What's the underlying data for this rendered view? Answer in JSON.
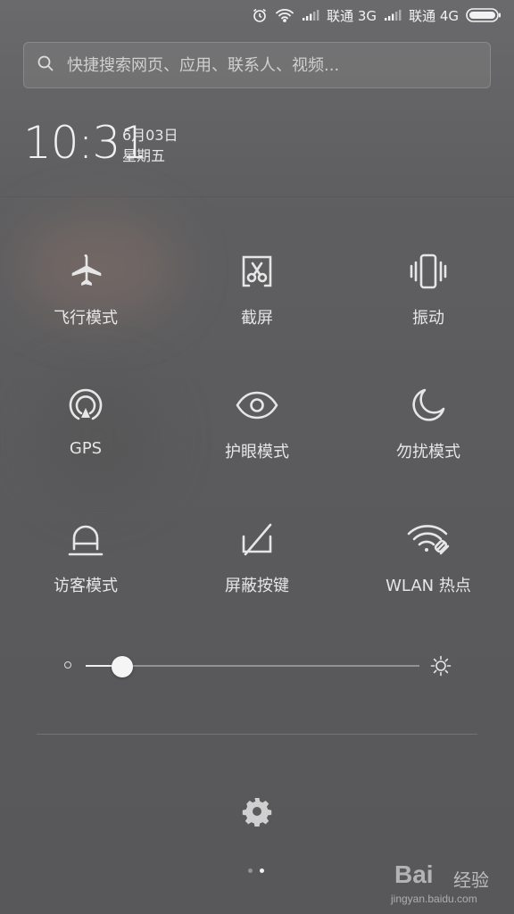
{
  "status_bar": {
    "carrier_1": "联通 3G",
    "carrier_2": "联通 4G",
    "icons": [
      "alarm-icon",
      "wifi-icon",
      "signal-icon",
      "battery-icon"
    ]
  },
  "search": {
    "placeholder": "快捷搜索网页、应用、联系人、视频..."
  },
  "clock": {
    "time": "10:31",
    "date": "6月03日",
    "weekday": "星期五"
  },
  "toggles": [
    {
      "label": "飞行模式",
      "icon": "airplane-icon"
    },
    {
      "label": "截屏",
      "icon": "screenshot-icon"
    },
    {
      "label": "振动",
      "icon": "vibrate-icon"
    },
    {
      "label": "GPS",
      "icon": "gps-icon"
    },
    {
      "label": "护眼模式",
      "icon": "eye-icon"
    },
    {
      "label": "勿扰模式",
      "icon": "moon-icon"
    },
    {
      "label": "访客模式",
      "icon": "guest-icon"
    },
    {
      "label": "屏蔽按键",
      "icon": "block-keys-icon"
    },
    {
      "label": "WLAN 热点",
      "icon": "hotspot-icon"
    }
  ],
  "brightness": {
    "level": 0.11
  },
  "pager": {
    "pages": 2,
    "active": 2
  },
  "watermark": {
    "brand": "Bai",
    "cn": "经验",
    "url": "jingyan.baidu.com"
  },
  "colors": {
    "icon": "#e6e6e6",
    "accent": "#f5f5f5"
  }
}
